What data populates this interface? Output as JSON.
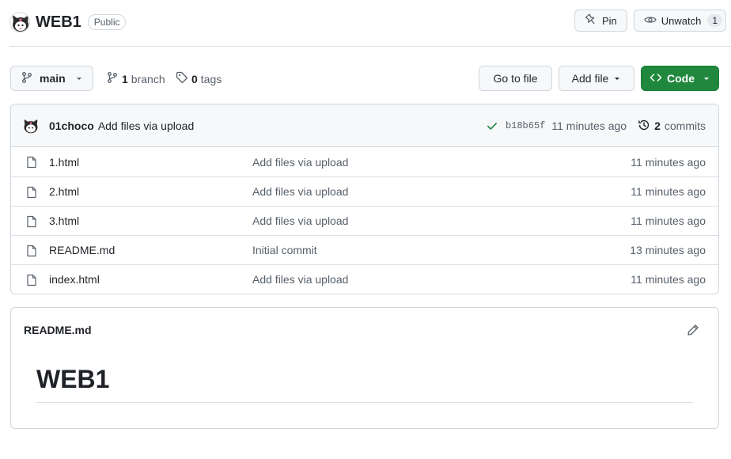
{
  "repo": {
    "name": "WEB1",
    "visibility": "Public"
  },
  "header_actions": {
    "pin_label": "Pin",
    "unwatch_label": "Unwatch",
    "watch_count": "1"
  },
  "branch_bar": {
    "current_branch": "main",
    "branch_count": "1",
    "branch_label": "branch",
    "tag_count": "0",
    "tag_label": "tags",
    "go_to_file_label": "Go to file",
    "add_file_label": "Add file",
    "code_label": "Code"
  },
  "latest_commit": {
    "author": "01choco",
    "message": "Add files via upload",
    "sha": "b18b65f",
    "time": "11 minutes ago",
    "commit_count": "2",
    "commits_label": "commits",
    "status_color": "#1a7f37"
  },
  "files": [
    {
      "name": "1.html",
      "message": "Add files via upload",
      "age": "11 minutes ago"
    },
    {
      "name": "2.html",
      "message": "Add files via upload",
      "age": "11 minutes ago"
    },
    {
      "name": "3.html",
      "message": "Add files via upload",
      "age": "11 minutes ago"
    },
    {
      "name": "README.md",
      "message": "Initial commit",
      "age": "13 minutes ago"
    },
    {
      "name": "index.html",
      "message": "Add files via upload",
      "age": "11 minutes ago"
    }
  ],
  "readme": {
    "filename": "README.md",
    "heading": "WEB1"
  },
  "colors": {
    "code_button": "#1f883d",
    "border": "#d0d7de",
    "muted_text": "#57606a"
  },
  "icons": {
    "repo_avatar": "kuromi-avatar-icon",
    "pin": "pin-icon",
    "eye": "eye-icon",
    "branch": "git-branch-icon",
    "tag": "tag-icon",
    "code": "code-brackets-icon",
    "check": "check-icon",
    "history": "history-icon",
    "file": "file-icon",
    "pencil": "pencil-icon"
  }
}
